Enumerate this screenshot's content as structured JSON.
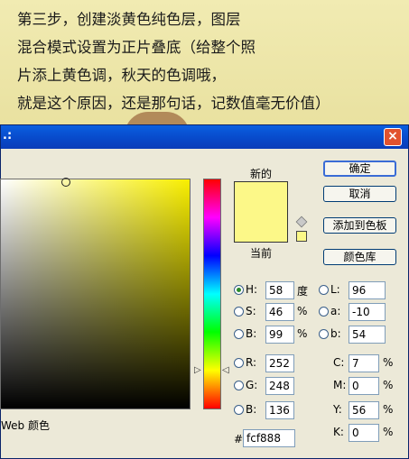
{
  "note": {
    "lines": [
      "第三步，创建淡黄色纯色层，图层",
      "混合模式设置为正片叠底（给整个照",
      "片添上黄色调，秋天的色调哦，",
      "就是这个原因，还是那句话，记数值毫无价值）"
    ]
  },
  "dialog": {
    "title": ".:",
    "close_glyph": "×",
    "new_label": "新的",
    "current_label": "当前",
    "web_colors_label": "Web 颜色",
    "buttons": {
      "ok": "确定",
      "cancel": "取消",
      "add_swatch": "添加到色板",
      "color_library": "颜色库"
    },
    "hsb": [
      {
        "label": "H:",
        "value": "58",
        "unit": "度",
        "selected": true
      },
      {
        "label": "S:",
        "value": "46",
        "unit": "%",
        "selected": false
      },
      {
        "label": "B:",
        "value": "99",
        "unit": "%",
        "selected": false
      }
    ],
    "rgb": [
      {
        "label": "R:",
        "value": "252"
      },
      {
        "label": "G:",
        "value": "248"
      },
      {
        "label": "B:",
        "value": "136"
      }
    ],
    "lab": [
      {
        "label": "L:",
        "value": "96"
      },
      {
        "label": "a:",
        "value": "-10"
      },
      {
        "label": "b:",
        "value": "54"
      }
    ],
    "cmyk": [
      {
        "label": "C:",
        "value": "7",
        "unit": "%"
      },
      {
        "label": "M:",
        "value": "0",
        "unit": "%"
      },
      {
        "label": "Y:",
        "value": "56",
        "unit": "%"
      },
      {
        "label": "K:",
        "value": "0",
        "unit": "%"
      }
    ],
    "hex_prefix": "#",
    "hex_value": "fcf888",
    "colors": {
      "new_color": "#fcf888",
      "current_color": "#fcf888",
      "field_hue": "#f9ef00"
    }
  }
}
